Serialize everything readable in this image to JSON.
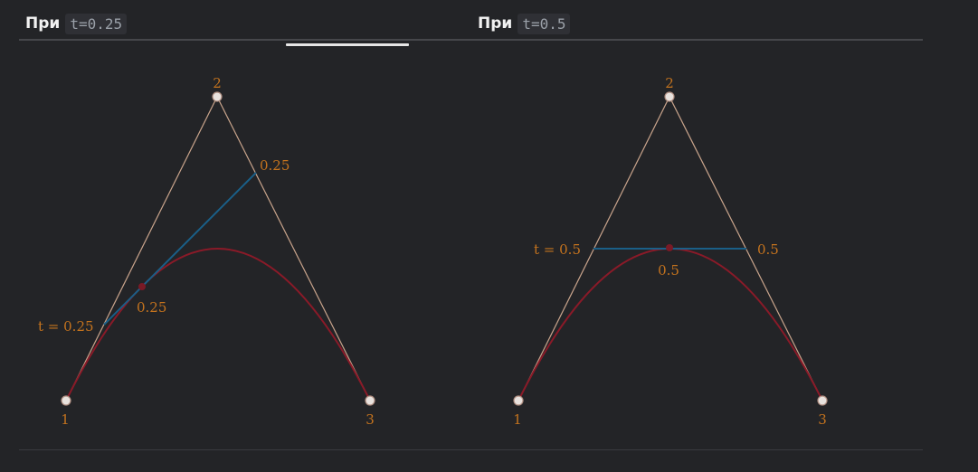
{
  "colors": {
    "background": "#232427",
    "hull": "#c9a48c",
    "curve": "#8a1a28",
    "tangent": "#1a5f88",
    "label": "#c4731e",
    "point_fill": "#e8e2de",
    "point_stroke": "#b08f82",
    "mid_point": "#7a1a26"
  },
  "tabs": [
    {
      "word": "При",
      "code": "t=0.25"
    },
    {
      "word": "При",
      "code": "t=0.5"
    }
  ],
  "panels": [
    {
      "t": 0.25,
      "labels": {
        "p1": "1",
        "p2": "2",
        "p3": "3",
        "t_left": "t = 0.25",
        "t_right": "0.25",
        "t_curve": "0.25"
      }
    },
    {
      "t": 0.5,
      "labels": {
        "p1": "1",
        "p2": "2",
        "p3": "3",
        "t_left": "t = 0.5",
        "t_right": "0.5",
        "t_curve": "0.5"
      }
    }
  ]
}
